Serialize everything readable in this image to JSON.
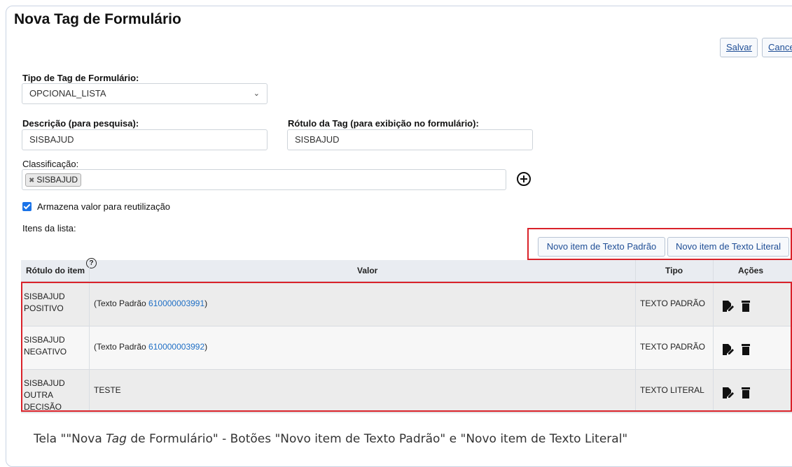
{
  "page": {
    "title": "Nova Tag de Formulário"
  },
  "toolbar": {
    "save_label": "Salvar",
    "cancel_label": "Cance"
  },
  "form": {
    "tipo_label": "Tipo de Tag de Formulário:",
    "tipo_value": "OPCIONAL_LISTA",
    "descricao_label": "Descrição (para pesquisa):",
    "descricao_value": "SISBAJUD",
    "rotulo_label": "Rótulo da Tag (para exibição no formulário):",
    "rotulo_value": "SISBAJUD",
    "classificacao_label": "Classificação:",
    "classificacao_chip": "SISBAJUD",
    "checkbox_label": "Armazena valor para reutilização",
    "checkbox_checked": true,
    "itens_label": "Itens da lista:"
  },
  "buttons": {
    "novo_padrao": "Novo item de Texto Padrão",
    "novo_literal": "Novo item de Texto Literal"
  },
  "table": {
    "headers": [
      "Rótulo do item",
      "Valor",
      "Tipo",
      "Ações"
    ],
    "rows": [
      {
        "label": "SISBAJUD POSITIVO",
        "value_prefix": "(Texto Padrão ",
        "value_link": "610000003991",
        "value_suffix": ")",
        "tipo": "TEXTO PADRÃO"
      },
      {
        "label": "SISBAJUD NEGATIVO",
        "value_prefix": "(Texto Padrão ",
        "value_link": "610000003992",
        "value_suffix": ")",
        "tipo": "TEXTO PADRÃO"
      },
      {
        "label": "SISBAJUD OUTRA DECISÃO",
        "value_prefix": "TESTE",
        "value_link": "",
        "value_suffix": "",
        "tipo": "TEXTO LITERAL"
      }
    ]
  },
  "icons": {
    "help": "help-circle-icon",
    "add": "plus-circle-icon",
    "edit": "edit-icon",
    "delete": "trash-icon",
    "remove": "close-icon",
    "dropdown": "chevron-down-icon"
  },
  "colors": {
    "highlight": "#d9222a",
    "link": "#1f6fc5",
    "checkbox": "#1a73e8"
  },
  "caption": {
    "part1": "Tela \"\"Nova ",
    "italic": "Tag",
    "part2": " de Formulário\" - Botões \"Novo item de Texto Padrão\" e \"Novo item de Texto Literal\""
  }
}
